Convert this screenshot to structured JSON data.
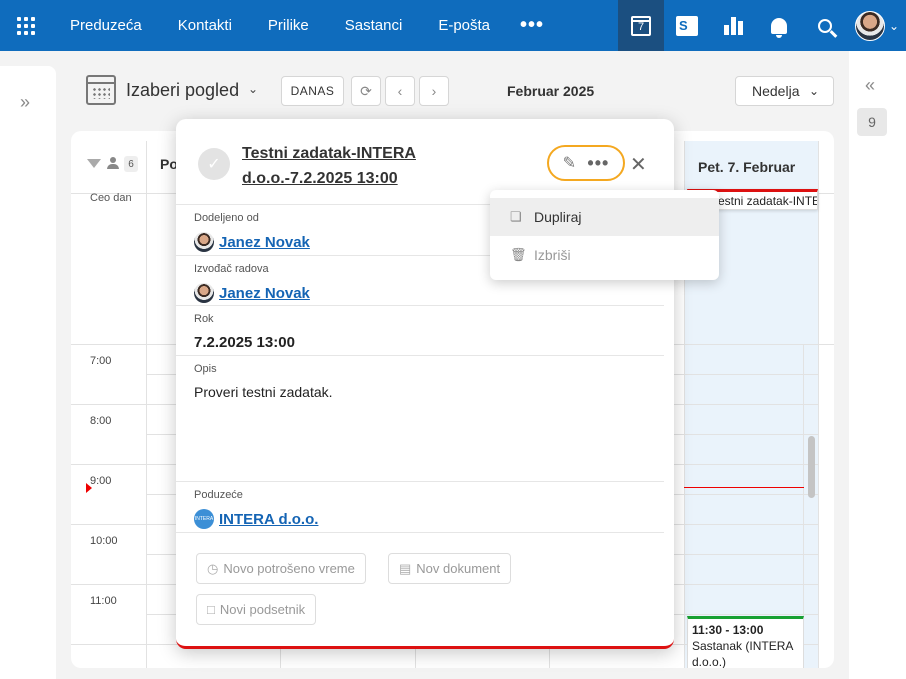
{
  "topbar": {
    "nav": [
      "Preduzeća",
      "Kontakti",
      "Prilike",
      "Sastanci",
      "E-pošta"
    ],
    "more": "•••",
    "calendar_day": "7"
  },
  "right_rail": {
    "badge": "9"
  },
  "toolbar": {
    "view_label": "Izaberi pogled",
    "today_label": "DANAS",
    "month": "Februar 2025",
    "range_select": "Nedelja"
  },
  "calendar": {
    "people_count": "6",
    "first_col_partial": "Po",
    "friday_header": "Pet. 7. Februar",
    "allday_label": "Ceo dan",
    "hours": [
      "7:00",
      "8:00",
      "9:00",
      "10:00",
      "11:00"
    ],
    "allday_event": "Testni zadatak-INTERA d.o.o.",
    "meeting_time": "11:30 - 13:00",
    "meeting_title": " Sastanak (INTERA d.o.o.)"
  },
  "popup": {
    "title": "Testni zadatak-INTERA d.o.o.-7.2.2025 13:00",
    "assigned_by_label": "Dodeljeno od",
    "assigned_by": "Janez Novak",
    "contractor_label": "Izvođač radova",
    "contractor": "Janez Novak",
    "due_label": "Rok",
    "due_value": "7.2.2025 13:00",
    "desc_label": "Opis",
    "desc_value": "Proveri testni zadatak.",
    "company_label": "Poduzeće",
    "company": "INTERA d.o.o.",
    "company_logo_text": "INTERA",
    "buttons": {
      "time_spent": "Novo potrošeno vreme",
      "new_doc": "Nov dokument",
      "new_reminder": "Novi podsetnik"
    }
  },
  "menu": {
    "duplicate": "Dupliraj",
    "delete": "Izbriši"
  },
  "colors": {
    "brand_blue": "#0f6cbd",
    "highlight_orange": "#f4a820",
    "task_red": "#dd1111",
    "meeting_green": "#18a032",
    "link_blue": "#1464b4"
  }
}
